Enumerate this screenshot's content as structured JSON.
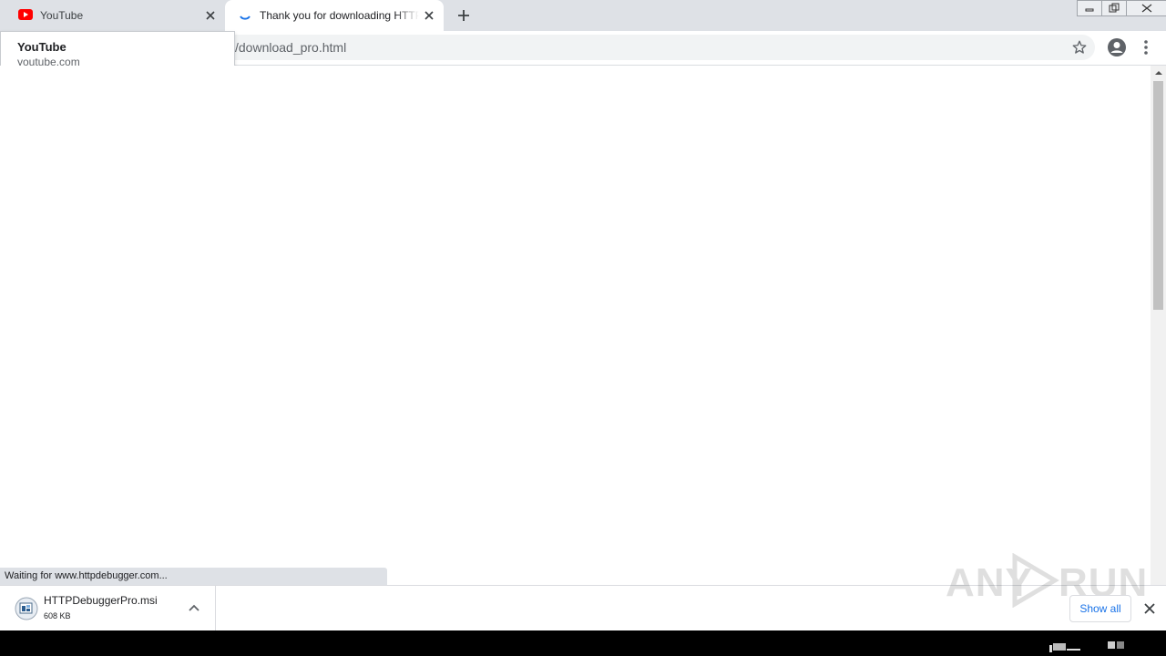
{
  "tabs": [
    {
      "title": "YouTube",
      "icon": "youtube-icon",
      "active": false
    },
    {
      "title": "Thank you for downloading HTTP Debugger",
      "icon": "loading-spinner-icon",
      "active": true
    }
  ],
  "hover_card": {
    "title": "YouTube",
    "domain": "youtube.com"
  },
  "toolbar": {
    "url": "/download_pro.html"
  },
  "status_bar": {
    "text": "Waiting for www.httpdebugger.com..."
  },
  "downloads": {
    "items": [
      {
        "name": "HTTPDebuggerPro.msi",
        "size": "608 KB",
        "icon": "msi-installer-icon"
      }
    ],
    "show_all_label": "Show all"
  },
  "watermark": {
    "left": "ANY",
    "right": "RUN"
  },
  "colors": {
    "accent": "#1a73e8",
    "youtube_red": "#ff0000",
    "tabstrip": "#dee1e6"
  }
}
